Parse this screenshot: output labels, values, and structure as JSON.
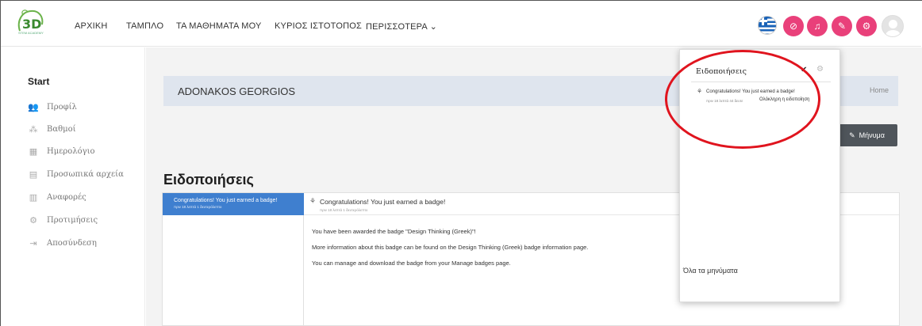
{
  "nav": {
    "logo_text": "3D",
    "logo_sub": "STEM ACADEMY",
    "items": [
      "ΑΡΧΙΚΗ",
      "ΤΑΜΠΛΟ",
      "ΤΑ ΜΑΘΗΜΑΤΑ ΜΟΥ",
      "ΚΥΡΙΟΣ ΙΣΤΟΤΟΠΟΣ",
      "ΠΕΡΙΣΣΟΤΕΡΑ ⌄"
    ],
    "language": "greek-flag-icon",
    "icons": [
      "eye-slash-icon",
      "bell-icon",
      "comment-icon",
      "gear-icon"
    ],
    "accent_color": "#e9407a"
  },
  "sidebar": {
    "title": "Start",
    "items": [
      {
        "label": "Προφίλ",
        "icon": "profile-icon"
      },
      {
        "label": "Βαθμοί",
        "icon": "grades-icon"
      },
      {
        "label": "Ημερολόγιο",
        "icon": "calendar-icon"
      },
      {
        "label": "Προσωπικά αρχεία",
        "icon": "file-icon"
      },
      {
        "label": "Αναφορές",
        "icon": "reports-icon"
      },
      {
        "label": "Προτιμήσεις",
        "icon": "preferences-icon"
      },
      {
        "label": "Αποσύνδεση",
        "icon": "logout-icon"
      }
    ]
  },
  "header": {
    "user_name": "ADONAKOS GEORGIOS",
    "home": "Home",
    "message_button": "Μήνυμα"
  },
  "page": {
    "title": "Ειδοποιήσεις",
    "list_item_title": "Congratulations! You just earned a badge!",
    "list_item_time": "πριν 18 λεπτά 1 δευτερόλεπτο",
    "detail_title": "Congratulations! You just earned a badge!",
    "detail_time": "πριν 18 λεπτά 1 δευτερόλεπτο",
    "detail_lines": [
      "You have been awarded the badge \"Design Thinking (Greek)\"!",
      "More information about this badge can be found on the Design Thinking (Greek) badge information page.",
      "You can manage and download the badge from your Manage badges page."
    ]
  },
  "dropdown": {
    "title": "Ειδοποιήσεις",
    "item_title": "Congratulations! You just earned a badge!",
    "item_time": "πριν 18 λεπτά 44 δευτε",
    "item_view": "Ολόκληρη η ειδοποίηση",
    "footer": "Όλα τα μηνύματα"
  },
  "colors": {
    "selected_item": "#3f7fcf",
    "header_bar": "#dfe5ee",
    "message_button": "#4f555b",
    "highlight_circle": "#e0141e"
  }
}
